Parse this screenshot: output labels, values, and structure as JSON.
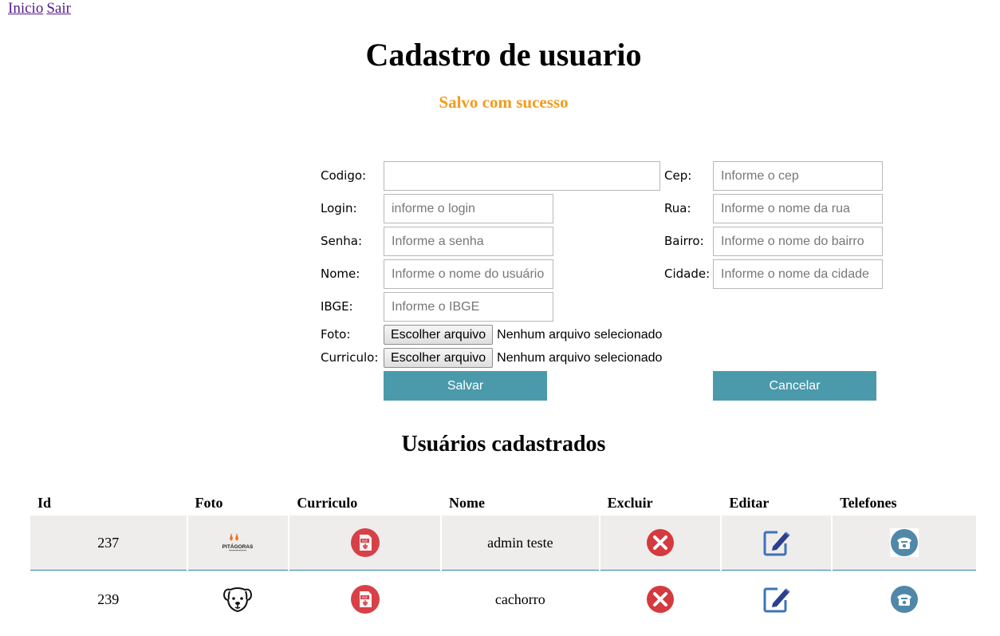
{
  "nav": {
    "home": "Inicio",
    "logout": "Sair"
  },
  "page": {
    "title": "Cadastro de usuario",
    "message": "Salvo com sucesso"
  },
  "colors": {
    "message": "#f29b1d",
    "button": "#4a9aab",
    "row_alt": "#efedeb",
    "row_border": "#2a8aa0"
  },
  "form": {
    "codigo": {
      "label": "Codigo:",
      "value": ""
    },
    "login": {
      "label": "Login:",
      "placeholder": "informe o login"
    },
    "senha": {
      "label": "Senha:",
      "placeholder": "Informe a senha"
    },
    "nome": {
      "label": "Nome:",
      "placeholder": "Informe o nome do usuário"
    },
    "ibge": {
      "label": "IBGE:",
      "placeholder": "Informe o IBGE"
    },
    "cep": {
      "label": "Cep:",
      "placeholder": "Informe o cep"
    },
    "rua": {
      "label": "Rua:",
      "placeholder": "Informe o nome da rua"
    },
    "bairro": {
      "label": "Bairro:",
      "placeholder": "Informe o nome do bairro"
    },
    "cidade": {
      "label": "Cidade:",
      "placeholder": "Informe o nome da cidade"
    },
    "foto": {
      "label": "Foto:",
      "button": "Escolher arquivo",
      "status": "Nenhum arquivo selecionado"
    },
    "curriculo": {
      "label": "Curriculo:",
      "button": "Escolher arquivo",
      "status": "Nenhum arquivo selecionado"
    },
    "save_label": "Salvar",
    "cancel_label": "Cancelar"
  },
  "table": {
    "title": "Usuários cadastrados",
    "headers": [
      "Id",
      "Foto",
      "Curriculo",
      "Nome",
      "Excluir",
      "Editar",
      "Telefones"
    ],
    "rows": [
      {
        "id": "237",
        "nome": "admin teste",
        "foto_icon": "pitagoras-logo-icon",
        "foto_logo_text": "PITÁGORAS"
      },
      {
        "id": "239",
        "nome": "cachorro",
        "foto_icon": "dog-face-icon"
      }
    ]
  }
}
